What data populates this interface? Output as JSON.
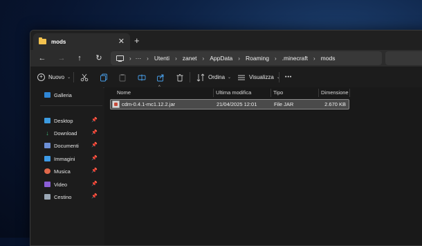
{
  "window": {
    "tab_title": "mods",
    "close_glyph": "✕",
    "newtab_glyph": "+"
  },
  "nav": {
    "back_glyph": "←",
    "forward_glyph": "→",
    "up_glyph": "↑",
    "refresh_glyph": "↻",
    "overflow": "···",
    "breadcrumbs": [
      "Utenti",
      "zanet",
      "AppData",
      "Roaming",
      ".minecraft",
      "mods"
    ],
    "separator": "›"
  },
  "toolbar": {
    "new_label": "Nuovo",
    "sort_label": "Ordina",
    "view_label": "Visualizza",
    "more_glyph": "•••",
    "chevron": "⌄"
  },
  "sidebar": {
    "gallery": {
      "label": "Galleria",
      "icon": "gallery-icon",
      "color": "#2f86d6"
    },
    "pin_glyph": "📌",
    "items": [
      {
        "label": "Desktop",
        "icon": "desktop-icon",
        "color": "#3c9be0"
      },
      {
        "label": "Download",
        "icon": "download-icon",
        "color": "#3cb878"
      },
      {
        "label": "Documenti",
        "icon": "documents-icon",
        "color": "#6c8fd6"
      },
      {
        "label": "Immagini",
        "icon": "pictures-icon",
        "color": "#3d9be8"
      },
      {
        "label": "Musica",
        "icon": "music-icon",
        "color": "#e0684a"
      },
      {
        "label": "Video",
        "icon": "video-icon",
        "color": "#8a5ed6"
      },
      {
        "label": "Cestino",
        "icon": "recycle-bin-icon",
        "color": "#9aa7b5"
      }
    ]
  },
  "files": {
    "columns": [
      "Nome",
      "Ultima modifica",
      "Tipo",
      "Dimensione"
    ],
    "rows": [
      {
        "name": "cdm-0.4.1-mc1.12.2.jar",
        "modified": "21/04/2025 12:01",
        "type": "File JAR",
        "size": "2.670 KB"
      }
    ]
  }
}
